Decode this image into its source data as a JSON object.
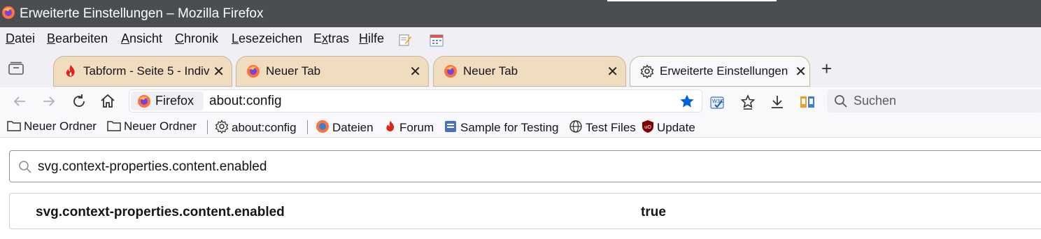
{
  "window": {
    "title": "Erweiterte Einstellungen – Mozilla Firefox"
  },
  "menubar": {
    "items": [
      {
        "label": "Datei",
        "accesskey": "D"
      },
      {
        "label": "Bearbeiten",
        "accesskey": "B"
      },
      {
        "label": "Ansicht",
        "accesskey": "A"
      },
      {
        "label": "Chronik",
        "accesskey": "C"
      },
      {
        "label": "Lesezeichen",
        "accesskey": "L"
      },
      {
        "label": "Extras",
        "accesskey": "x"
      },
      {
        "label": "Hilfe",
        "accesskey": "H"
      }
    ]
  },
  "tabs": [
    {
      "label": "Tabform - Seite 5 - Indiv",
      "icon": "flame-icon",
      "active": false
    },
    {
      "label": "Neuer Tab",
      "icon": "firefox-icon",
      "active": false
    },
    {
      "label": "Neuer Tab",
      "icon": "firefox-icon",
      "active": false
    },
    {
      "label": "Erweiterte Einstellungen",
      "icon": "gear-icon",
      "active": true
    }
  ],
  "tab_close_glyph": "✕",
  "new_tab_glyph": "+",
  "navbar": {
    "identity_label": "Firefox",
    "url": "about:config",
    "search_placeholder": "Suchen"
  },
  "bookmarks": [
    {
      "label": "Neuer Ordner",
      "icon": "folder-icon"
    },
    {
      "label": "Neuer Ordner",
      "icon": "folder-icon"
    },
    {
      "label": "about:config",
      "icon": "gear-icon"
    },
    {
      "label": "Dateien",
      "icon": "firefox-icon"
    },
    {
      "label": "Forum",
      "icon": "flame-icon"
    },
    {
      "label": "Sample for Testing",
      "icon": "document-icon"
    },
    {
      "label": "Test Files",
      "icon": "globe-icon"
    },
    {
      "label": "Update",
      "icon": "ublock-icon"
    }
  ],
  "config": {
    "search_value": "svg.context-properties.content.enabled",
    "pref_name": "svg.context-properties.content.enabled",
    "pref_value": "true"
  },
  "colors": {
    "titlebar": "#4a4e52",
    "tab_inactive": "#f0dcbe",
    "accent_star": "#0061e0"
  }
}
